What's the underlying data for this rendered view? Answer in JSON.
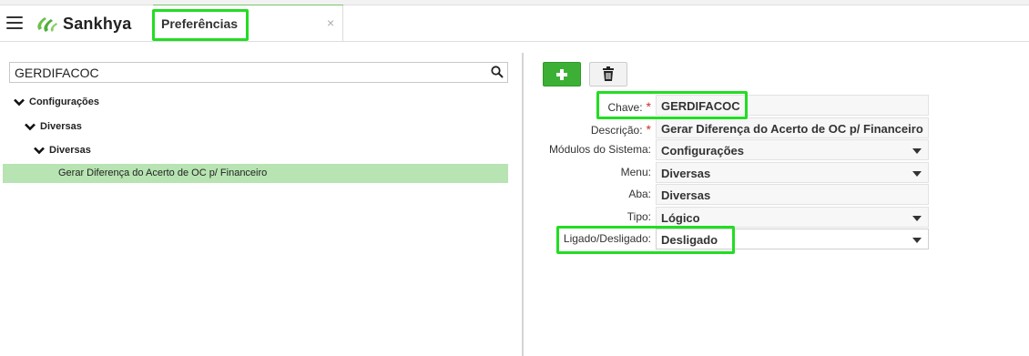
{
  "header": {
    "app_name": "Sankhya",
    "tab_label": "Preferências",
    "close_glyph": "×",
    "icons": [
      "menu-icon",
      "sankhya-logo-icon",
      "close-icon"
    ]
  },
  "tree": {
    "search_value": "GERDIFACOC",
    "nodes": {
      "level1": "Configurações",
      "level2": "Diversas",
      "level3": "Diversas",
      "leaf": "Gerar Diferença do Acerto de OC p/ Financeiro"
    }
  },
  "toolbar": {
    "add_icon": "plus-icon",
    "delete_icon": "trash-icon"
  },
  "form": {
    "chave_label": "Chave:",
    "chave_value": "GERDIFACOC",
    "descricao_label": "Descrição:",
    "descricao_value": "Gerar Diferença do Acerto de OC p/ Financeiro",
    "modulos_label": "Módulos do Sistema:",
    "modulos_value": "Configurações",
    "menu_label": "Menu:",
    "menu_value": "Diversas",
    "aba_label": "Aba:",
    "aba_value": "Diversas",
    "tipo_label": "Tipo:",
    "tipo_value": "Lógico",
    "ligado_label": "Ligado/Desligado:",
    "ligado_value": "Desligado",
    "required_mark": "*"
  },
  "colors": {
    "brand_green": "#5cb84a",
    "add_button": "#3cb035",
    "selected_row": "#b7e4b2",
    "highlight": "#22dd22",
    "required": "#c9302c"
  }
}
